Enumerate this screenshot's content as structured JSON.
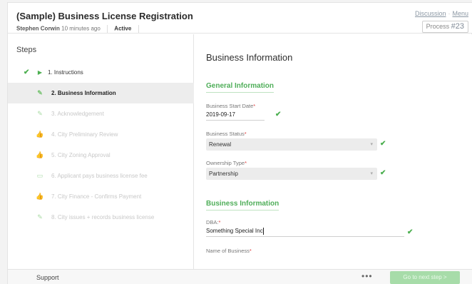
{
  "header": {
    "title": "(Sample) Business License Registration",
    "author": "Stephen Corwin",
    "time": "10 minutes ago",
    "status": "Active",
    "links": {
      "discussion": "Discussion",
      "menu": "Menu"
    },
    "process_label": "Process",
    "process_number": "#23"
  },
  "steps": {
    "title": "Steps",
    "items": [
      {
        "label": "1. Instructions",
        "icon": "chevron-right-icon",
        "state": "done"
      },
      {
        "label": "2. Business Information",
        "icon": "pencil-icon",
        "state": "active"
      },
      {
        "label": "3. Acknowledgement",
        "icon": "pencil-icon",
        "state": "pending"
      },
      {
        "label": "4. City Preliminary Review",
        "icon": "thumbs-up-icon",
        "state": "pending"
      },
      {
        "label": "5. City Zoning Approval",
        "icon": "thumbs-up-icon",
        "state": "pending"
      },
      {
        "label": "6. Applicant pays business license fee",
        "icon": "payment-icon",
        "state": "pending"
      },
      {
        "label": "7. City Finance - Confirms Payment",
        "icon": "thumbs-up-icon",
        "state": "pending"
      },
      {
        "label": "8. City issues + records business license",
        "icon": "pencil-icon",
        "state": "pending"
      }
    ]
  },
  "form": {
    "heading": "Business Information",
    "section_general": "General Information",
    "start_date": {
      "label": "Business Start Date",
      "value": "2019-09-17"
    },
    "status": {
      "label": "Business Status",
      "value": "Renewal"
    },
    "ownership": {
      "label": "Ownership Type",
      "value": "Partnership"
    },
    "section_business": "Business Information",
    "dba": {
      "label": "DBA:",
      "value": "Something Special Inc"
    },
    "name_of_business": {
      "label": "Name of Business"
    },
    "required_mark": "*"
  },
  "footer": {
    "support": "Support",
    "more": "•••",
    "next": "Go to next step >"
  },
  "colors": {
    "accent_green": "#4fae59",
    "button_green": "#a7dca9"
  }
}
